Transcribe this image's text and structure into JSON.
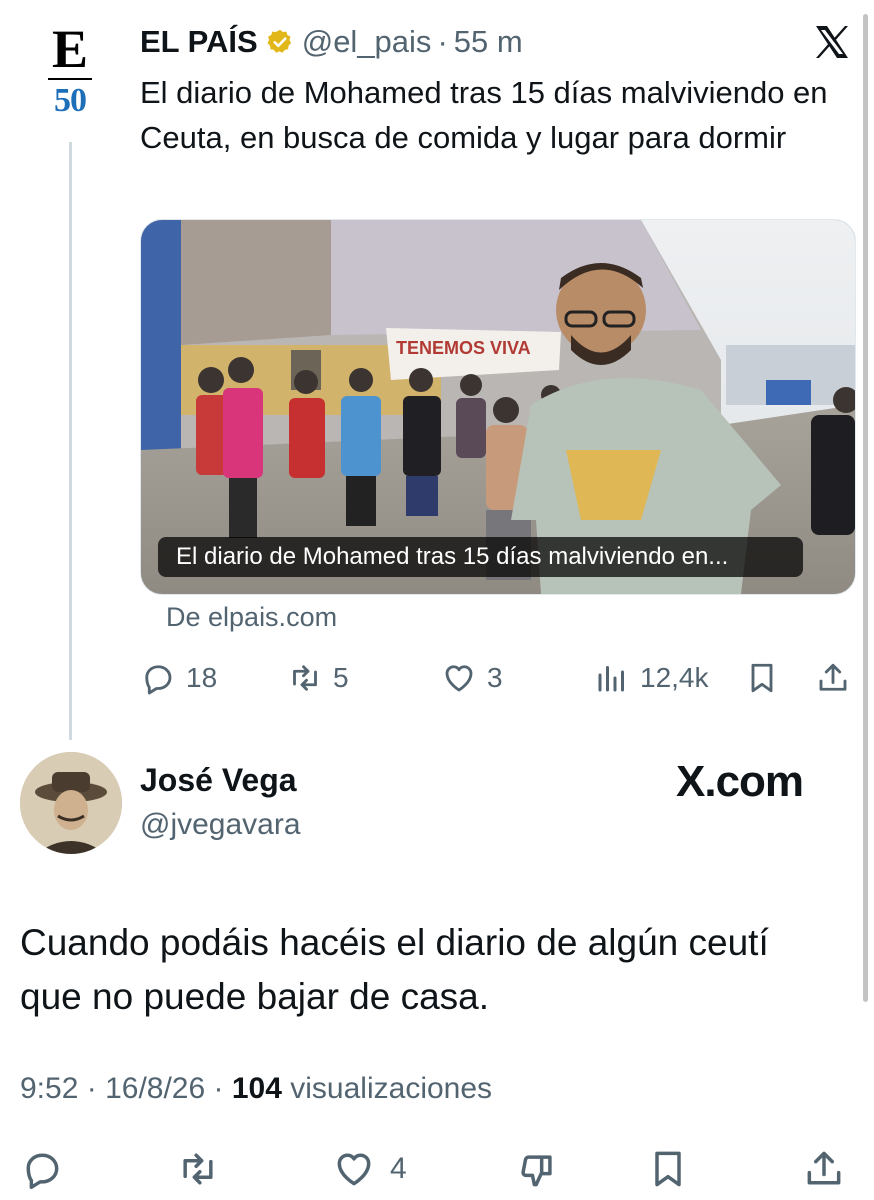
{
  "quoted_tweet": {
    "author_name": "EL PAÍS",
    "handle": "@el_pais",
    "separator": "·",
    "time_ago": "55 m",
    "avatar_logo": {
      "letter": "E",
      "number": "50"
    },
    "text": "El diario de Mohamed tras 15 días malviviendo en Ceuta, en busca de comida y lugar para dormir",
    "card": {
      "caption": "El diario de Mohamed tras 15 días malviviendo en...",
      "banner_text": "TENEMOS VIVA"
    },
    "source": "De elpais.com",
    "actions": {
      "replies": "18",
      "retweets": "5",
      "likes": "3",
      "views": "12,4k"
    },
    "icons": [
      "reply-icon",
      "retweet-icon",
      "like-icon",
      "views-icon",
      "bookmark-icon",
      "share-icon",
      "x-logo-icon",
      "verified-badge-icon"
    ]
  },
  "reply_tweet": {
    "author_name": "José Vega",
    "handle": "@jvegavara",
    "watermark": "X.com",
    "text": "Cuando podáis hacéis el diario de algún ceutí que no puede bajar de casa.",
    "meta": {
      "time": "9:52",
      "separator": "·",
      "date": "16/8/26",
      "views_count": "104",
      "views_label": "visualizaciones"
    },
    "actions": {
      "likes": "4"
    }
  },
  "colors": {
    "text": "#0f1419",
    "muted": "#536471",
    "verified_gold": "#e2b719",
    "thread_line": "#cfd9de",
    "logo_blue": "#1d6fb8"
  }
}
